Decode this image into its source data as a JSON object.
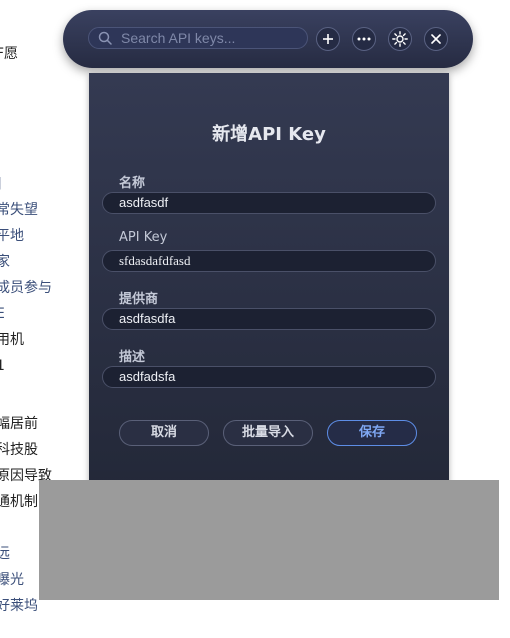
{
  "background_text": [
    {
      "text": "F愿",
      "style": "dark"
    },
    {
      "text": "]",
      "style": "blue"
    },
    {
      "text": "常失望",
      "style": "blue"
    },
    {
      "text": "平地",
      "style": "blue"
    },
    {
      "text": "家",
      "style": "blue"
    },
    {
      "text": "成员参与",
      "style": "blue"
    },
    {
      "text": "E",
      "style": "blue"
    },
    {
      "text": "用机",
      "style": "dark"
    },
    {
      "text": "1",
      "style": "dark"
    },
    {
      "text": "幅居前",
      "style": "dark"
    },
    {
      "text": "科技股",
      "style": "dark"
    },
    {
      "text": "原因导致",
      "style": "dark"
    },
    {
      "text": "通机制",
      "style": "dark"
    },
    {
      "text": "远",
      "style": "blue"
    },
    {
      "text": "曝光",
      "style": "blue"
    },
    {
      "text": "好莱坞",
      "style": "blue"
    }
  ],
  "toolbar": {
    "search_placeholder": "Search API keys...",
    "search_value": "",
    "icons": [
      "search-icon",
      "plus-icon",
      "more-icon",
      "settings-icon",
      "close-icon"
    ]
  },
  "dialog": {
    "title": "新增API Key",
    "fields": {
      "name": {
        "label": "名称",
        "value": "asdfasdf"
      },
      "api_key": {
        "label": "API Key",
        "value": "sfdasdafdfasd"
      },
      "provider": {
        "label": "提供商",
        "value": "asdfasdfa"
      },
      "description": {
        "label": "描述",
        "value": "asdfadsfa"
      }
    },
    "buttons": {
      "cancel": "取消",
      "import": "批量导入",
      "save": "保存"
    }
  },
  "colors": {
    "toolbar_bg": "#2f3550",
    "dialog_bg": "#2b3045",
    "accent": "#7fa8f3",
    "overlay": "#9b9b9b"
  }
}
